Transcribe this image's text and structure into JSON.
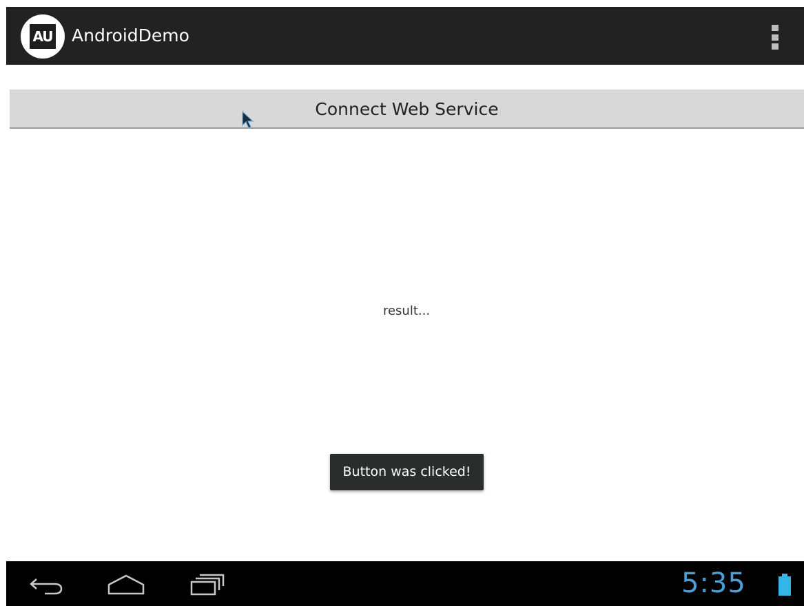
{
  "action_bar": {
    "icon_text": "AU",
    "title": "AndroidDemo",
    "overflow_icon": "overflow-menu-icon"
  },
  "main": {
    "connect_button_label": "Connect Web Service",
    "result_text": "result..."
  },
  "toast": {
    "message": "Button was clicked!"
  },
  "nav_bar": {
    "back_icon": "back-icon",
    "home_icon": "home-icon",
    "recents_icon": "recents-icon",
    "clock": "5:35",
    "battery_icon": "battery-icon"
  },
  "colors": {
    "action_bar_bg": "#222222",
    "button_bg": "#d8d8d8",
    "toast_bg": "#2a2d2b",
    "clock": "#4aa0d8",
    "battery": "#33b5e5"
  }
}
